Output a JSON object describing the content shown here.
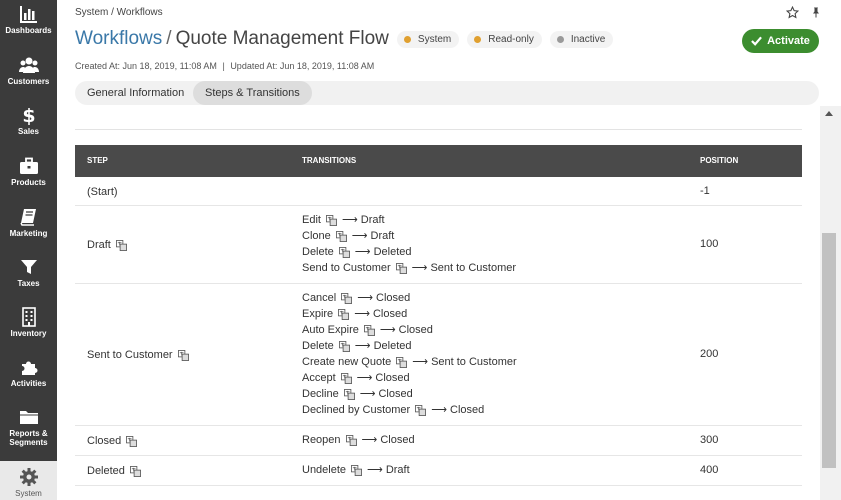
{
  "sidebar": {
    "items": [
      {
        "label": "Dashboards",
        "icon": "bar-chart-icon"
      },
      {
        "label": "Customers",
        "icon": "users-icon"
      },
      {
        "label": "Sales",
        "icon": "dollar-icon"
      },
      {
        "label": "Products",
        "icon": "briefcase-icon"
      },
      {
        "label": "Marketing",
        "icon": "book-icon"
      },
      {
        "label": "Taxes",
        "icon": "filter-icon"
      },
      {
        "label": "Inventory",
        "icon": "building-icon"
      },
      {
        "label": "Activities",
        "icon": "puzzle-icon"
      },
      {
        "label": "Reports &",
        "label2": "Segments",
        "icon": "folder-icon"
      },
      {
        "label": "System",
        "icon": "gear-icon"
      }
    ]
  },
  "header": {
    "breadcrumb": "System / Workflows",
    "title_link": "Workflows",
    "title_sep": "/",
    "title": "Quote Management Flow",
    "badges": [
      {
        "label": "System",
        "color": "#e0a030"
      },
      {
        "label": "Read-only",
        "color": "#e0a030"
      },
      {
        "label": "Inactive",
        "color": "#9a9a9a"
      }
    ],
    "created_at": "Created At: Jun 18, 2019, 11:08 AM",
    "separator": "|",
    "updated_at": "Updated At: Jun 18, 2019, 11:08 AM",
    "activate_label": "Activate"
  },
  "tabs": [
    "General Information",
    "Steps & Transitions"
  ],
  "colors": {
    "accent_green": "#3c8d2f",
    "link_blue": "#3a78a8",
    "table_header": "#4a4a4a"
  },
  "table": {
    "columns": [
      "Step",
      "Transitions",
      "Position"
    ],
    "arrow": "⟶",
    "rows": [
      {
        "step": "(Start)",
        "step_icon": false,
        "position": "-1",
        "transitions": []
      },
      {
        "step": "Draft",
        "step_icon": true,
        "position": "100",
        "transitions": [
          {
            "name": "Edit",
            "target": "Draft"
          },
          {
            "name": "Clone",
            "target": "Draft"
          },
          {
            "name": "Delete",
            "target": "Deleted"
          },
          {
            "name": "Send to Customer",
            "target": "Sent to Customer"
          }
        ]
      },
      {
        "step": "Sent to Customer",
        "step_icon": true,
        "position": "200",
        "transitions": [
          {
            "name": "Cancel",
            "target": "Closed"
          },
          {
            "name": "Expire",
            "target": "Closed"
          },
          {
            "name": "Auto Expire",
            "target": "Closed"
          },
          {
            "name": "Delete",
            "target": "Deleted"
          },
          {
            "name": "Create new Quote",
            "target": "Sent to Customer"
          },
          {
            "name": "Accept",
            "target": "Closed"
          },
          {
            "name": "Decline",
            "target": "Closed"
          },
          {
            "name": "Declined by Customer",
            "target": "Closed"
          }
        ]
      },
      {
        "step": "Closed",
        "step_icon": true,
        "position": "300",
        "transitions": [
          {
            "name": "Reopen",
            "target": "Closed"
          }
        ]
      },
      {
        "step": "Deleted",
        "step_icon": true,
        "position": "400",
        "transitions": [
          {
            "name": "Undelete",
            "target": "Draft"
          }
        ]
      }
    ]
  }
}
